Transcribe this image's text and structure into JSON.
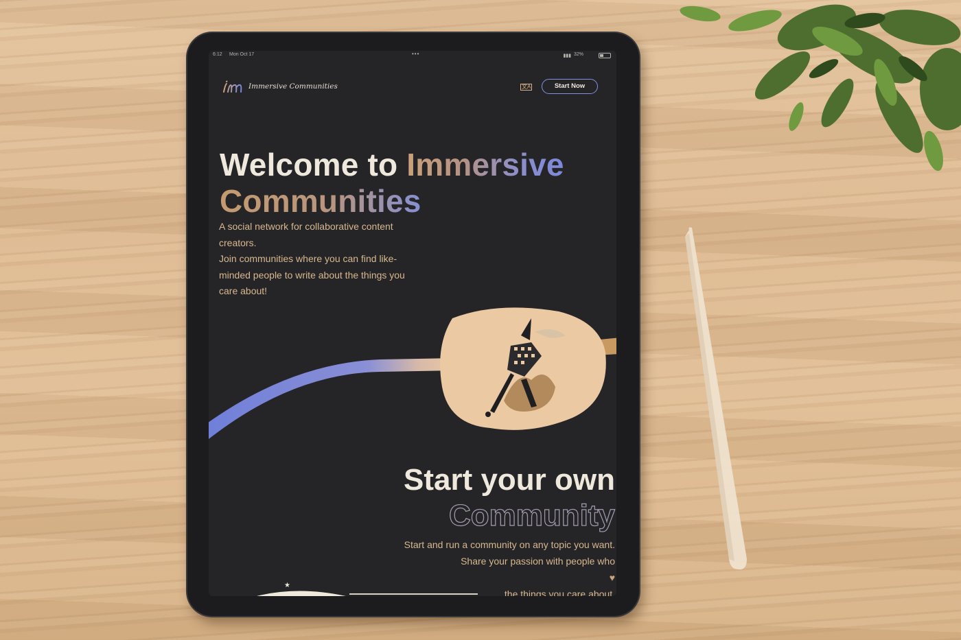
{
  "status_bar": {
    "time": "6:12",
    "date": "Mon Oct 17",
    "battery": "32%"
  },
  "nav": {
    "logo_mark": "im",
    "logo_text": "Immersive Communities",
    "language_icon": "translate-icon",
    "start_button": "Start Now"
  },
  "hero": {
    "title_plain": "Welcome to ",
    "title_accent_1": "Immersive",
    "title_accent_2": "Communities",
    "description": [
      "A social network for collaborative content",
      "creators.",
      "Join communities where you can find like-",
      "minded people to write about the things you",
      "care about!"
    ]
  },
  "section2": {
    "title_line1": "Start your own",
    "title_line2": "Community",
    "line1": "Start and run a community on any topic you want.",
    "line2_before": "Share your passion with people who ",
    "line2_heart": "♥",
    "line2_after": " the things you care about."
  },
  "colors": {
    "screen_bg": "#252427",
    "text_light": "#efe8dc",
    "text_tan": "#d8b98f",
    "accent_blue": "#7b88de",
    "accent_tan": "#caa27a",
    "blob": "#ebc9a3"
  }
}
